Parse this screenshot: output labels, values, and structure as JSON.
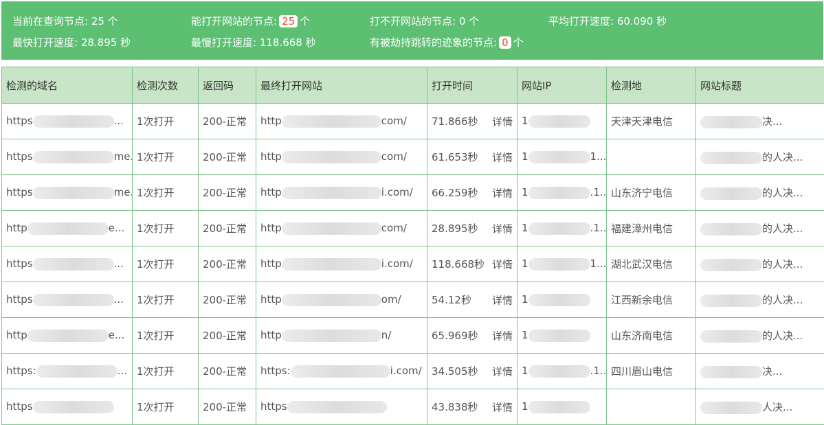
{
  "summary": {
    "querying_label": "当前在查询节点: 25 个",
    "open_label": "能打开网站的节点:",
    "open_count": "25",
    "open_unit": "个",
    "fail_label": "打不开网站的节点: 0 个",
    "avg_label": "平均打开速度: 60.090 秒",
    "fastest_label": "最快打开速度: 28.895 秒",
    "slowest_label": "最慢打开速度: 118.668 秒",
    "hijack_label": "有被劫持跳转的迹象的节点:",
    "hijack_count": "0",
    "hijack_unit": "个"
  },
  "table": {
    "headers": [
      "检测的域名",
      "检测次数",
      "返回码",
      "最终打开网站",
      "打开时间",
      "网站IP",
      "检测地",
      "网站标题"
    ],
    "rows": [
      {
        "domain_a": "https",
        "domain_b": "...",
        "count": "1次打开",
        "code": "200-正常",
        "final_a": "http",
        "final_b": "com/",
        "time": "71.866秒",
        "detail": "详情",
        "ip_a": "1",
        "ip_b": "",
        "loc": "天津天津电信",
        "title_a": "",
        "title_b": "决..."
      },
      {
        "domain_a": "https",
        "domain_b": "me...",
        "count": "1次打开",
        "code": "200-正常",
        "final_a": "http",
        "final_b": "com/",
        "time": "61.653秒",
        "detail": "详情",
        "ip_a": "1",
        "ip_b": "1...",
        "loc": "",
        "title_a": "",
        "title_b": "的人决..."
      },
      {
        "domain_a": "https",
        "domain_b": "me...",
        "count": "1次打开",
        "code": "200-正常",
        "final_a": "http",
        "final_b": "i.com/",
        "time": "66.259秒",
        "detail": "详情",
        "ip_a": "1",
        "ip_b": ".1...",
        "loc": "山东济宁电信",
        "title_a": "",
        "title_b": "的人决..."
      },
      {
        "domain_a": "http",
        "domain_b": "e...",
        "count": "1次打开",
        "code": "200-正常",
        "final_a": "http",
        "final_b": "com/",
        "time": "28.895秒",
        "detail": "详情",
        "ip_a": "1",
        "ip_b": ".1...",
        "loc": "福建漳州电信",
        "title_a": "",
        "title_b": "的人决..."
      },
      {
        "domain_a": "https",
        "domain_b": "...",
        "count": "1次打开",
        "code": "200-正常",
        "final_a": "http",
        "final_b": "i.com/",
        "time": "118.668秒",
        "detail": "详情",
        "ip_a": "1",
        "ip_b": "1...",
        "loc": "湖北武汉电信",
        "title_a": "",
        "title_b": "的人决..."
      },
      {
        "domain_a": "https",
        "domain_b": "...",
        "count": "1次打开",
        "code": "200-正常",
        "final_a": "http",
        "final_b": "om/",
        "time": "54.12秒",
        "detail": "详情",
        "ip_a": "1",
        "ip_b": "",
        "loc": "江西新余电信",
        "title_a": "",
        "title_b": "的人决..."
      },
      {
        "domain_a": "http",
        "domain_b": "e...",
        "count": "1次打开",
        "code": "200-正常",
        "final_a": "http",
        "final_b": "n/",
        "time": "65.969秒",
        "detail": "详情",
        "ip_a": "1",
        "ip_b": "",
        "loc": "山东济南电信",
        "title_a": "",
        "title_b": "的人决..."
      },
      {
        "domain_a": "https:",
        "domain_b": "...",
        "count": "1次打开",
        "code": "200-正常",
        "final_a": "https:",
        "final_b": "i.com/",
        "time": "34.505秒",
        "detail": "详情",
        "ip_a": "1",
        "ip_b": ".1...",
        "loc": "四川眉山电信",
        "title_a": "",
        "title_b": "决..."
      },
      {
        "domain_a": "https",
        "domain_b": "",
        "count": "1次打开",
        "code": "200-正常",
        "final_a": "https",
        "final_b": "",
        "time": "43.838秒",
        "detail": "详情",
        "ip_a": "1",
        "ip_b": "",
        "loc": "",
        "title_a": "",
        "title_b": "人决..."
      }
    ]
  }
}
